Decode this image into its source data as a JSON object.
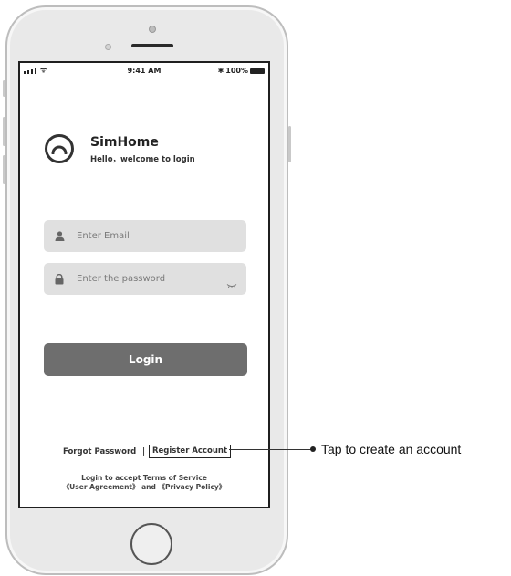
{
  "status_bar": {
    "time": "9:41 AM",
    "battery": "100%",
    "wifi_glyph": "ᯤ"
  },
  "app": {
    "name": "SimHome",
    "subtitle": "Hello，welcome to login",
    "logo_icon": "logo-icon"
  },
  "form": {
    "email_placeholder": "Enter Email",
    "email_icon": "user-icon",
    "password_placeholder": "Enter the password",
    "password_icon": "lock-icon",
    "password_toggle_icon": "eye-closed-icon",
    "login_label": "Login"
  },
  "links": {
    "forgot": "Forgot Password",
    "divider": "|",
    "register": "Register  Account"
  },
  "terms": {
    "line1": "Login to accept Terms of Service",
    "line2": "《User Agreement》 and 《Privacy Policy》"
  },
  "callout": {
    "text": "Tap to create an account"
  },
  "colors": {
    "field_bg": "#e0e0e0",
    "button_bg": "#6e6e6e",
    "frame": "#1f1f1f"
  }
}
